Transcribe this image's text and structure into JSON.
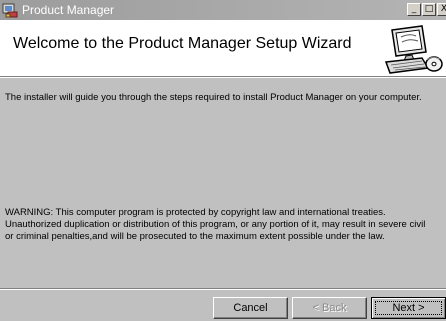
{
  "window": {
    "title": "Product Manager",
    "controls": {
      "minimize": "_",
      "maximize": "□",
      "close": "X"
    }
  },
  "header": {
    "title": "Welcome to the Product Manager Setup Wizard",
    "icon": "computer-setup-icon"
  },
  "body": {
    "intro": "The installer will guide you through the steps required to install Product Manager on your computer.",
    "warning_lines": [
      "WARNING: This computer program is protected by copyright law and international treaties.",
      "Unauthorized duplication or distribution of this program, or any portion of it, may result in severe civil",
      "or criminal penalties,and will be prosecuted to the maximum extent possible under the law."
    ]
  },
  "buttons": {
    "cancel": "Cancel",
    "back": "< Back",
    "next": "Next >"
  },
  "colors": {
    "dialog_bg": "#c0c0c0",
    "header_bg": "#ffffff",
    "titlebar": "#a8a8a8"
  }
}
